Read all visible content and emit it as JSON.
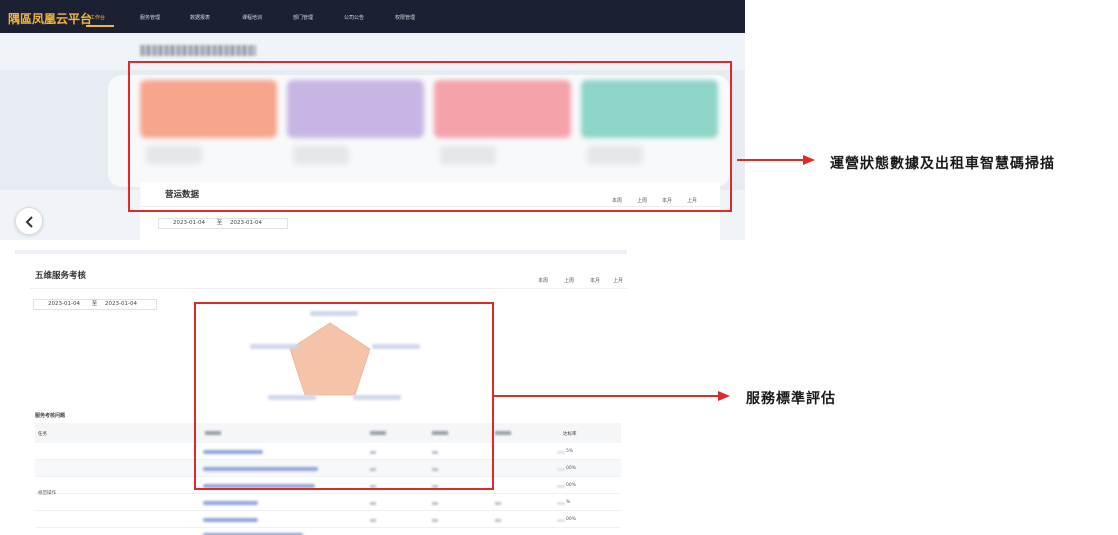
{
  "nav": {
    "brand": "隅區凤凰云平台",
    "items": [
      "工作台",
      "服务管理",
      "数据报表",
      "课程培训",
      "部门管理",
      "公司公告",
      "权限管理"
    ],
    "active_index": 0
  },
  "operations": {
    "title": "营运数据",
    "period_tabs": [
      "本周",
      "上周",
      "本月",
      "上月"
    ],
    "date_start": "2023-01-04",
    "date_separator": "至",
    "date_end": "2023-01-04"
  },
  "evaluation": {
    "title": "五维服务考核",
    "period_tabs": [
      "本周",
      "上周",
      "本月",
      "上月"
    ],
    "date_start": "2023-01-04",
    "date_separator": "至",
    "date_end": "2023-01-04",
    "issues_title": "服务考核问题",
    "table_headers": {
      "category": "任务",
      "rate": "达标率"
    },
    "group_label": "规范操作",
    "rate_values": [
      "5%",
      "00%",
      "00%",
      "%",
      "00%"
    ]
  },
  "colors": {
    "nav_bg": "#1b2133",
    "brand_accent": "#f3b53c",
    "card_colors": [
      "#f7a58c",
      "#c7b6e3",
      "#f5a3ab",
      "#8ed5c8"
    ],
    "radar_fill": "#f5c4a8",
    "highlight": "#e02a2a"
  },
  "annotations": {
    "top": "運營狀態數據及出租車智慧碼掃描",
    "bottom": "服務標準評估"
  },
  "icons": {
    "back": "chevron-left-icon"
  }
}
